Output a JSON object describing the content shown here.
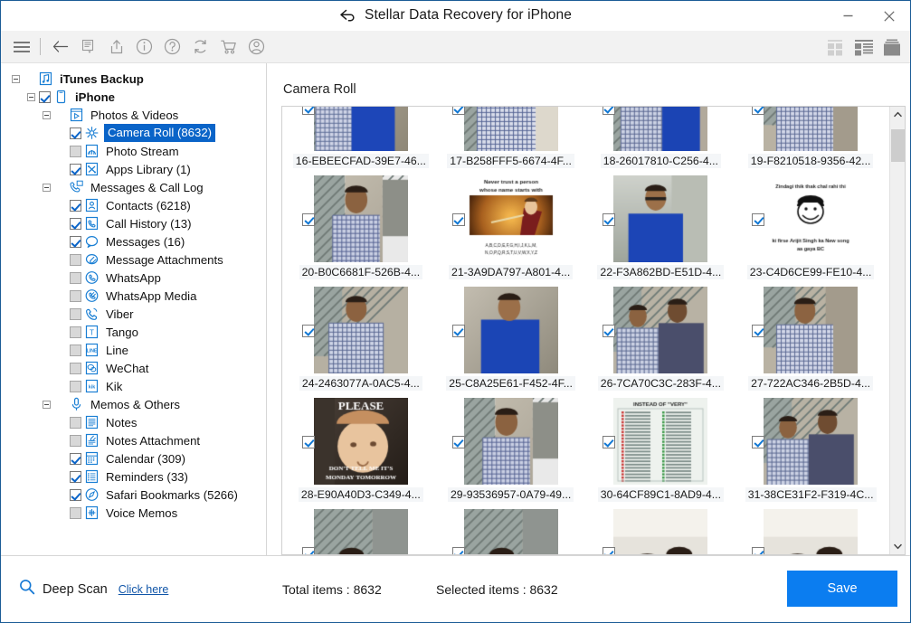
{
  "window": {
    "title": "Stellar Data Recovery for iPhone",
    "back_icon": "back-arrow-icon",
    "minimize_label": "Minimize",
    "close_label": "Close"
  },
  "toolbar": {
    "items": [
      {
        "name": "menu-icon",
        "label": "Menu"
      },
      {
        "name": "back-icon",
        "label": "Back"
      },
      {
        "name": "list-dropdown-icon",
        "label": "Select View"
      },
      {
        "name": "share-icon",
        "label": "Share"
      },
      {
        "name": "info-icon",
        "label": "Info"
      },
      {
        "name": "help-icon",
        "label": "Help"
      },
      {
        "name": "refresh-icon",
        "label": "Refresh"
      },
      {
        "name": "cart-icon",
        "label": "Buy Now"
      },
      {
        "name": "account-icon",
        "label": "Account"
      }
    ],
    "view_modes": [
      {
        "name": "tiles-view-icon",
        "label": "Tiles",
        "active": false
      },
      {
        "name": "list-view-icon",
        "label": "List",
        "active": false
      },
      {
        "name": "large-icons-view-icon",
        "label": "Large Icons",
        "active": true
      }
    ]
  },
  "sidebar": {
    "items": [
      {
        "label": "iTunes Backup",
        "icon": "itunes-icon",
        "depth": 0,
        "expander": "minus",
        "checkbox": "none",
        "bold": true,
        "selected": false
      },
      {
        "label": "iPhone",
        "icon": "iphone-icon",
        "depth": 1,
        "expander": "minus",
        "checkbox": "checked",
        "bold": true,
        "selected": false
      },
      {
        "label": "Photos & Videos",
        "icon": "photos-videos-icon",
        "depth": 2,
        "expander": "minus",
        "checkbox": "none",
        "bold": false,
        "selected": false
      },
      {
        "label": "Camera Roll (8632)",
        "icon": "camera-roll-icon",
        "depth": 3,
        "expander": "none",
        "checkbox": "checked",
        "bold": false,
        "selected": true
      },
      {
        "label": "Photo Stream",
        "icon": "photo-stream-icon",
        "depth": 3,
        "expander": "none",
        "checkbox": "gray",
        "bold": false,
        "selected": false
      },
      {
        "label": "Apps Library (1)",
        "icon": "apps-library-icon",
        "depth": 3,
        "expander": "none",
        "checkbox": "checked",
        "bold": false,
        "selected": false
      },
      {
        "label": "Messages & Call Log",
        "icon": "messages-call-log-icon",
        "depth": 2,
        "expander": "minus",
        "checkbox": "none",
        "bold": false,
        "selected": false
      },
      {
        "label": "Contacts (6218)",
        "icon": "contacts-icon",
        "depth": 3,
        "expander": "none",
        "checkbox": "checked",
        "bold": false,
        "selected": false
      },
      {
        "label": "Call History (13)",
        "icon": "call-history-icon",
        "depth": 3,
        "expander": "none",
        "checkbox": "checked",
        "bold": false,
        "selected": false
      },
      {
        "label": "Messages (16)",
        "icon": "messages-icon",
        "depth": 3,
        "expander": "none",
        "checkbox": "checked",
        "bold": false,
        "selected": false
      },
      {
        "label": "Message Attachments",
        "icon": "message-attachments-icon",
        "depth": 3,
        "expander": "none",
        "checkbox": "gray",
        "bold": false,
        "selected": false
      },
      {
        "label": "WhatsApp",
        "icon": "whatsapp-icon",
        "depth": 3,
        "expander": "none",
        "checkbox": "gray",
        "bold": false,
        "selected": false
      },
      {
        "label": "WhatsApp Media",
        "icon": "whatsapp-media-icon",
        "depth": 3,
        "expander": "none",
        "checkbox": "gray",
        "bold": false,
        "selected": false
      },
      {
        "label": "Viber",
        "icon": "viber-icon",
        "depth": 3,
        "expander": "none",
        "checkbox": "gray",
        "bold": false,
        "selected": false
      },
      {
        "label": "Tango",
        "icon": "tango-icon",
        "depth": 3,
        "expander": "none",
        "checkbox": "gray",
        "bold": false,
        "selected": false
      },
      {
        "label": "Line",
        "icon": "line-icon",
        "depth": 3,
        "expander": "none",
        "checkbox": "gray",
        "bold": false,
        "selected": false
      },
      {
        "label": "WeChat",
        "icon": "wechat-icon",
        "depth": 3,
        "expander": "none",
        "checkbox": "gray",
        "bold": false,
        "selected": false
      },
      {
        "label": "Kik",
        "icon": "kik-icon",
        "depth": 3,
        "expander": "none",
        "checkbox": "gray",
        "bold": false,
        "selected": false
      },
      {
        "label": "Memos & Others",
        "icon": "memos-others-icon",
        "depth": 2,
        "expander": "minus",
        "checkbox": "none",
        "bold": false,
        "selected": false
      },
      {
        "label": "Notes",
        "icon": "notes-icon",
        "depth": 3,
        "expander": "none",
        "checkbox": "gray",
        "bold": false,
        "selected": false
      },
      {
        "label": "Notes Attachment",
        "icon": "notes-attachment-icon",
        "depth": 3,
        "expander": "none",
        "checkbox": "gray",
        "bold": false,
        "selected": false
      },
      {
        "label": "Calendar (309)",
        "icon": "calendar-icon",
        "depth": 3,
        "expander": "none",
        "checkbox": "checked",
        "bold": false,
        "selected": false
      },
      {
        "label": "Reminders (33)",
        "icon": "reminders-icon",
        "depth": 3,
        "expander": "none",
        "checkbox": "checked",
        "bold": false,
        "selected": false
      },
      {
        "label": "Safari Bookmarks (5266)",
        "icon": "safari-bookmarks-icon",
        "depth": 3,
        "expander": "none",
        "checkbox": "checked",
        "bold": false,
        "selected": false
      },
      {
        "label": "Voice Memos",
        "icon": "voice-memos-icon",
        "depth": 3,
        "expander": "none",
        "checkbox": "gray",
        "bold": false,
        "selected": false
      }
    ]
  },
  "content": {
    "title": "Camera Roll",
    "thumbnails": [
      {
        "label": "16-EBEECFAD-39E7-46...",
        "checked": true,
        "kind": "photo-person-blue",
        "clipped_top": true
      },
      {
        "label": "17-B258FFF5-6674-4F...",
        "checked": true,
        "kind": "photo-person-check",
        "clipped_top": true
      },
      {
        "label": "18-26017810-C256-4...",
        "checked": true,
        "kind": "photo-person-gate",
        "clipped_top": true
      },
      {
        "label": "19-F8210518-9356-42...",
        "checked": true,
        "kind": "photo-person-wall",
        "clipped_top": true
      },
      {
        "label": "20-B0C6681F-526B-4...",
        "checked": true,
        "kind": "photo-person-window"
      },
      {
        "label": "21-3A9DA797-A801-4...",
        "checked": true,
        "kind": "meme-never-trust"
      },
      {
        "label": "22-F3A862BD-E51D-4...",
        "checked": true,
        "kind": "photo-person-blueshirt"
      },
      {
        "label": "23-C4D6CE99-FE10-4...",
        "checked": true,
        "kind": "meme-zindagi"
      },
      {
        "label": "24-2463077A-0AC5-4...",
        "checked": true,
        "kind": "photo-person-check2"
      },
      {
        "label": "25-C8A25E61-F452-4F...",
        "checked": true,
        "kind": "photo-person-blue2"
      },
      {
        "label": "26-7CA70C3C-283F-4...",
        "checked": true,
        "kind": "photo-two-people"
      },
      {
        "label": "27-722AC346-2B5D-4...",
        "checked": true,
        "kind": "photo-person-wall2"
      },
      {
        "label": "28-E90A40D3-C349-4...",
        "checked": true,
        "kind": "meme-please-baby"
      },
      {
        "label": "29-93536957-0A79-49...",
        "checked": true,
        "kind": "photo-person-window2"
      },
      {
        "label": "30-64CF89C1-8AD9-4...",
        "checked": true,
        "kind": "meme-instead-of-very"
      },
      {
        "label": "31-38CE31F2-F319-4C...",
        "checked": true,
        "kind": "photo-two-people2"
      },
      {
        "label": "",
        "checked": true,
        "kind": "photo-woman-gate",
        "clipped_bottom": true
      },
      {
        "label": "",
        "checked": true,
        "kind": "photo-woman-gate2",
        "clipped_bottom": true
      },
      {
        "label": "",
        "checked": true,
        "kind": "photo-couple-indoor",
        "clipped_bottom": true
      },
      {
        "label": "",
        "checked": true,
        "kind": "photo-couple-indoor2",
        "clipped_bottom": true
      }
    ],
    "meme_texts": {
      "never_trust_line1": "Never trust a person",
      "never_trust_line2": "whose name starts with",
      "never_trust_line3": "A,B,C,D,E,F,G,H,I,J,K,L,M,",
      "never_trust_line4": "N,O,P,Q,R,S,T,U,V,W,X,Y,Z",
      "zindagi_line1": "Zindagi thik thak chal rahi thi",
      "zindagi_line2": "ki firse Arijit Singh ka New song",
      "zindagi_line3": "aa gaya BC",
      "please_line1": "PLEASE",
      "please_line2": "DON'T TELL ME IT'S",
      "please_line3": "MONDAY TOMORROW",
      "instead_title": "INSTEAD OF \"VERY\""
    },
    "scrollbar": {
      "up_label": "Scroll up",
      "down_label": "Scroll down",
      "thumb_label": "Scroll thumb"
    }
  },
  "statusbar": {
    "deep_scan_label": "Deep Scan",
    "deep_scan_link": "Click here",
    "deep_scan_icon": "search-icon",
    "total_items": "Total items : 8632",
    "selected_items": "Selected items : 8632",
    "save_label": "Save"
  },
  "colors": {
    "accent": "#0b7df0",
    "selection": "#0a64c8",
    "titlebar_border": "#1b5c96",
    "toolbar_bg": "#f2f2f2",
    "link": "#1055a8"
  }
}
